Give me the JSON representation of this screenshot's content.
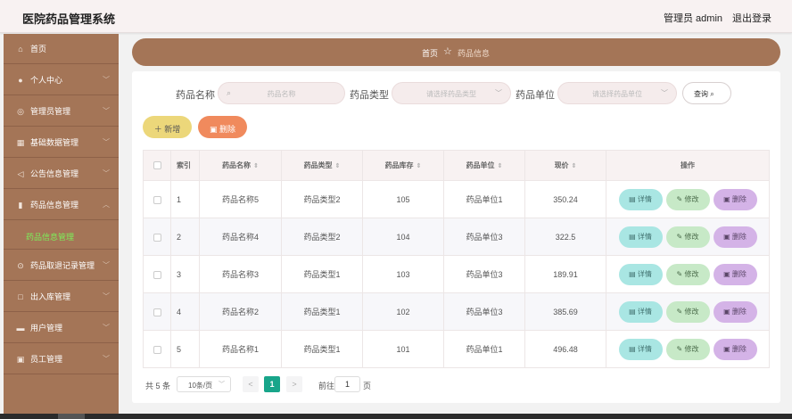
{
  "app": {
    "title": "医院药品管理系统"
  },
  "header": {
    "user_label": "管理员 admin",
    "logout_label": "退出登录"
  },
  "sidebar": {
    "items": [
      {
        "label": "首页",
        "icon": "home-icon",
        "has_chevron": false
      },
      {
        "label": "个人中心",
        "icon": "user-icon",
        "has_chevron": true
      },
      {
        "label": "管理员管理",
        "icon": "admin-icon",
        "has_chevron": true
      },
      {
        "label": "基础数据管理",
        "icon": "grid-icon",
        "has_chevron": true
      },
      {
        "label": "公告信息管理",
        "icon": "megaphone-icon",
        "has_chevron": true
      },
      {
        "label": "药品信息管理",
        "icon": "chart-icon",
        "has_chevron": true,
        "expanded": true
      },
      {
        "label": "药品取退记录管理",
        "icon": "record-icon",
        "has_chevron": true
      },
      {
        "label": "出入库管理",
        "icon": "box-icon",
        "has_chevron": true
      },
      {
        "label": "用户管理",
        "icon": "users-icon",
        "has_chevron": true
      },
      {
        "label": "员工管理",
        "icon": "staff-icon",
        "has_chevron": true
      }
    ],
    "active_sub": "药品信息管理"
  },
  "breadcrumb": {
    "home": "首页",
    "current": "药品信息"
  },
  "filters": {
    "name_label": "药品名称",
    "name_placeholder": "药品名称",
    "type_label": "药品类型",
    "type_placeholder": "请选择药品类型",
    "unit_label": "药品单位",
    "unit_placeholder": "请选择药品单位",
    "search_label": "查询"
  },
  "toolbar": {
    "add_label": "新增",
    "delete_label": "删除"
  },
  "table": {
    "headers": [
      "索引",
      "药品名称",
      "药品类型",
      "药品库存",
      "药品单位",
      "现价",
      "操作"
    ],
    "rows": [
      {
        "index": "1",
        "name": "药品名称5",
        "type": "药品类型2",
        "stock": "105",
        "unit": "药品单位1",
        "price": "350.24"
      },
      {
        "index": "2",
        "name": "药品名称4",
        "type": "药品类型2",
        "stock": "104",
        "unit": "药品单位3",
        "price": "322.5"
      },
      {
        "index": "3",
        "name": "药品名称3",
        "type": "药品类型1",
        "stock": "103",
        "unit": "药品单位3",
        "price": "189.91"
      },
      {
        "index": "4",
        "name": "药品名称2",
        "type": "药品类型1",
        "stock": "102",
        "unit": "药品单位3",
        "price": "385.69"
      },
      {
        "index": "5",
        "name": "药品名称1",
        "type": "药品类型1",
        "stock": "101",
        "unit": "药品单位1",
        "price": "496.48"
      }
    ],
    "actions": {
      "detail": "详情",
      "edit": "修改",
      "delete": "删除"
    }
  },
  "pagination": {
    "total": "共 5 条",
    "page_size": "10条/页",
    "prev": "<",
    "current": "1",
    "next": ">",
    "goto_label": "前往",
    "goto_value": "1",
    "goto_unit": "页"
  },
  "colors": {
    "brand": "#a47557",
    "active_sub": "#7cf05a",
    "page_current": "#18a58a",
    "add_button": "#ecd77a",
    "delete_button": "#f08a5d"
  }
}
